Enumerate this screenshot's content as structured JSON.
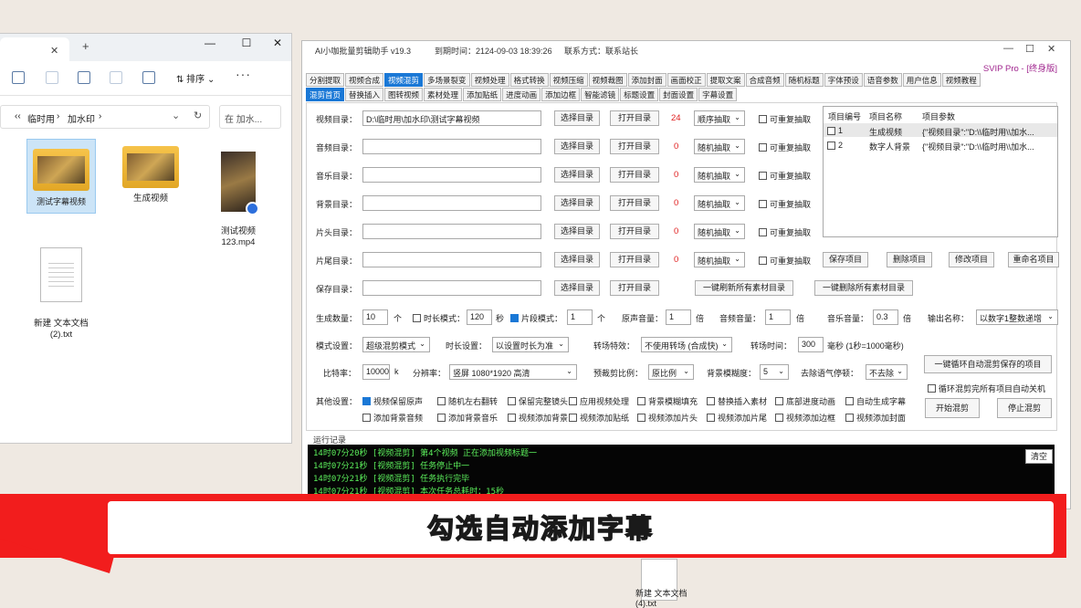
{
  "explorer": {
    "close_glyph": "✕",
    "new_tab_glyph": "+",
    "window_controls": [
      "—",
      "☐",
      "✕"
    ],
    "sort_label": "排序",
    "more_glyph": "···",
    "breadcrumb": [
      "‹‹",
      "临时用",
      "›",
      "加水印",
      "›"
    ],
    "search_placeholder": "在 加水...",
    "files": [
      {
        "name": "测试字幕视频",
        "type": "folder"
      },
      {
        "name": "生成视频",
        "type": "folder"
      },
      {
        "name": "测试视频\n123.mp4",
        "type": "video"
      },
      {
        "name": "新建 文本文档\n(2).txt",
        "type": "text"
      }
    ]
  },
  "tool": {
    "title": "AI小咖批量剪辑助手 v19.3",
    "expire": "到期时间：2124-09-03 18:39:26",
    "contact": "联系方式：联系站长",
    "svip": "SVIP Pro - [终身版]",
    "tabs_row1": [
      "分割提取",
      "视频合成",
      "视频混剪",
      "多场景裂变",
      "视频处理",
      "格式转换",
      "视频压缩",
      "视频裁图",
      "添加封面",
      "画面校正",
      "提取文案",
      "合成音频",
      "随机标题",
      "字体预设",
      "语音参数",
      "用户信息",
      "视频教程"
    ],
    "tabs_row2": [
      "混剪首页",
      "替换插入",
      "图转视频",
      "素材处理",
      "添加贴纸",
      "进度动画",
      "添加边框",
      "智能滤镜",
      "标题设置",
      "封面设置",
      "字幕设置"
    ],
    "directories": [
      {
        "label": "视频目录：",
        "path": "D:\\临时用\\加水印\\测试字幕视频",
        "count": "24",
        "mode": "顺序抽取"
      },
      {
        "label": "音频目录：",
        "path": "",
        "count": "0",
        "mode": "随机抽取"
      },
      {
        "label": "音乐目录：",
        "path": "",
        "count": "0",
        "mode": "随机抽取"
      },
      {
        "label": "背景目录：",
        "path": "",
        "count": "0",
        "mode": "随机抽取"
      },
      {
        "label": "片头目录：",
        "path": "",
        "count": "0",
        "mode": "随机抽取"
      },
      {
        "label": "片尾目录：",
        "path": "",
        "count": "0",
        "mode": "随机抽取"
      }
    ],
    "save_dir_label": "保存目录：",
    "choose_dir": "选择目录",
    "open_dir": "打开目录",
    "repeat_extract": "可重复抽取",
    "refresh_btn": "一键刷新所有素材目录",
    "delete_all_btn": "一键删除所有素材目录",
    "projects": {
      "headers": [
        "项目编号",
        "项目名称",
        "项目参数"
      ],
      "rows": [
        {
          "id": "1",
          "name": "生成视频",
          "params": "{\"视频目录\":\"D:\\\\临时用\\\\加水..."
        },
        {
          "id": "2",
          "name": "数字人背景",
          "params": "{\"视频目录\":\"D:\\\\临时用\\\\加水..."
        }
      ],
      "buttons": [
        "保存项目",
        "删除项目",
        "修改项目",
        "重命名项目"
      ]
    },
    "row_gen": {
      "count_label": "生成数量：",
      "count": "10",
      "unit_ge": "个",
      "duration_mode": "时长模式：",
      "duration": "120",
      "unit_sec": "秒",
      "segment_mode": "片段模式：",
      "segment": "1",
      "unit_ge2": "个",
      "orig_vol_label": "原声音量：",
      "orig_vol": "1",
      "unit_bei": "倍",
      "audio_vol_label": "音频音量：",
      "audio_vol": "1",
      "unit_bei2": "倍",
      "music_vol_label": "音乐音量：",
      "music_vol": "0.3",
      "unit_bei3": "倍",
      "output_label": "输出名称：",
      "output": "以数字1整数递增"
    },
    "row_mode": {
      "mode_label": "模式设置：",
      "mode": "超级混剪模式",
      "dur_label": "时长设置：",
      "dur": "以设置时长为准",
      "trans_label": "转场特效：",
      "trans": "不使用转场 (合成快)",
      "trans_time_label": "转场时间：",
      "trans_time": "300",
      "trans_unit": "毫秒 (1秒=1000毫秒)"
    },
    "row_bitrate": {
      "bitrate_label": "比特率：",
      "bitrate": "10000",
      "unit_k": "k",
      "res_label": "分辨率：",
      "res": "竖屏  1080*1920  高清",
      "crop_label": "预裁剪比例：",
      "crop": "原比例",
      "blur_label": "背景模糊度：",
      "blur": "5",
      "stop_label": "去除语气停顿：",
      "stop": "不去除"
    },
    "other_label": "其他设置：",
    "options_row1": [
      {
        "text": "视频保留原声",
        "checked": true
      },
      {
        "text": "随机左右翻转",
        "checked": false
      },
      {
        "text": "保留完整镜头",
        "checked": false
      },
      {
        "text": "应用视频处理",
        "checked": false
      },
      {
        "text": "背景模糊填充",
        "checked": false
      },
      {
        "text": "替换插入素材",
        "checked": false
      },
      {
        "text": "底部进度动画",
        "checked": false
      },
      {
        "text": "自动生成字幕",
        "checked": false
      }
    ],
    "options_row2": [
      {
        "text": "添加背景音频",
        "checked": false
      },
      {
        "text": "添加背景音乐",
        "checked": false
      },
      {
        "text": "视频添加背景",
        "checked": false
      },
      {
        "text": "视频添加贴纸",
        "checked": false
      },
      {
        "text": "视频添加片头",
        "checked": false
      },
      {
        "text": "视频添加片尾",
        "checked": false
      },
      {
        "text": "视频添加边框",
        "checked": false
      },
      {
        "text": "视频添加封面",
        "checked": false
      }
    ],
    "loop_btn": "一键循环自动混剪保存的项目",
    "shutdown_chk": "循环混剪完所有项目自动关机",
    "start_btn": "开始混剪",
    "stop_btn": "停止混剪",
    "log_label": "运行记录",
    "clear_btn": "清空",
    "log_lines": [
      "14时07分20秒 [视频混剪] 第4个视频 正在添加视频标题一",
      "14时07分21秒 [视频混剪] 任务停止中一",
      "14时07分21秒 [视频混剪] 任务执行完毕",
      "14时07分21秒 [视频混剪] 本次任务总耗时：15秒"
    ]
  },
  "banner": {
    "text": "勾选自动添加字幕"
  },
  "desktop": {
    "file_label": "新建 文本文档\n(4).txt"
  },
  "colors": {
    "banner_red": "#f21d1d",
    "banner_text": "#f6d51c",
    "accent": "#1a78d6"
  }
}
